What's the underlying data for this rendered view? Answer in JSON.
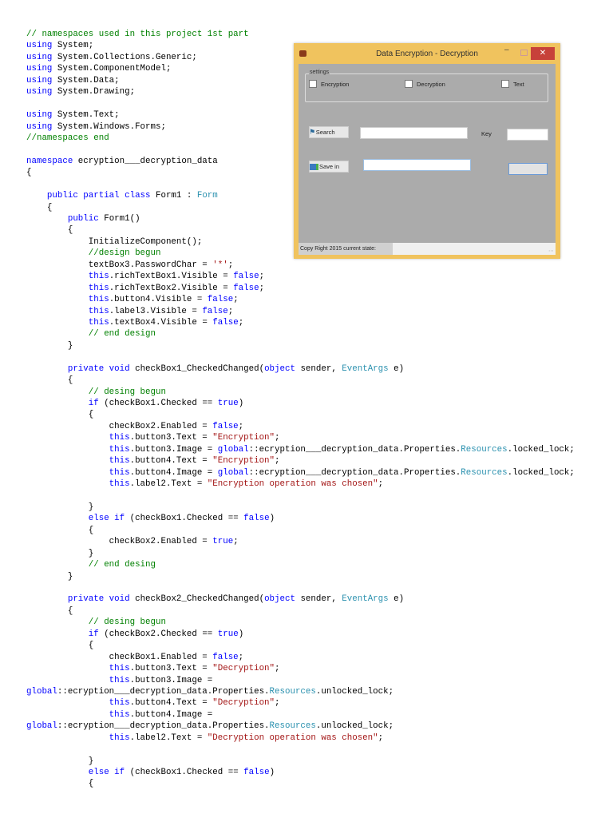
{
  "code_colors": {
    "keyword": "#0000ff",
    "comment": "#008000",
    "string": "#a31515",
    "type": "#2b91af"
  },
  "code_lines": [
    [
      [
        "// namespaces used in this project 1st part",
        "c"
      ]
    ],
    [
      [
        "using",
        "k"
      ],
      [
        " System;",
        "p"
      ]
    ],
    [
      [
        "using",
        "k"
      ],
      [
        " System.Collections.Generic;",
        "p"
      ]
    ],
    [
      [
        "using",
        "k"
      ],
      [
        " System.ComponentModel;",
        "p"
      ]
    ],
    [
      [
        "using",
        "k"
      ],
      [
        " System.Data;",
        "p"
      ]
    ],
    [
      [
        "using",
        "k"
      ],
      [
        " System.Drawing;",
        "p"
      ]
    ],
    [],
    [
      [
        "using",
        "k"
      ],
      [
        " System.Text;",
        "p"
      ]
    ],
    [
      [
        "using",
        "k"
      ],
      [
        " System.Windows.Forms;",
        "p"
      ]
    ],
    [
      [
        "//namespaces end",
        "c"
      ]
    ],
    [],
    [
      [
        "namespace",
        "k"
      ],
      [
        " ecryption___decryption_data",
        "p"
      ]
    ],
    [
      [
        "{",
        "p"
      ]
    ],
    [],
    [
      [
        "    ",
        "p"
      ],
      [
        "public partial class",
        "k"
      ],
      [
        " Form1 : ",
        "p"
      ],
      [
        "Form",
        "t"
      ]
    ],
    [
      [
        "    {",
        "p"
      ]
    ],
    [
      [
        "        ",
        "p"
      ],
      [
        "public",
        "k"
      ],
      [
        " Form1()",
        "p"
      ]
    ],
    [
      [
        "        {",
        "p"
      ]
    ],
    [
      [
        "            InitializeComponent();",
        "p"
      ]
    ],
    [
      [
        "            ",
        "p"
      ],
      [
        "//design begun",
        "c"
      ]
    ],
    [
      [
        "            textBox3.PasswordChar = ",
        "p"
      ],
      [
        "'*'",
        "s"
      ],
      [
        ";",
        "p"
      ]
    ],
    [
      [
        "            ",
        "p"
      ],
      [
        "this",
        "k"
      ],
      [
        ".richTextBox1.Visible = ",
        "p"
      ],
      [
        "false",
        "k"
      ],
      [
        ";",
        "p"
      ]
    ],
    [
      [
        "            ",
        "p"
      ],
      [
        "this",
        "k"
      ],
      [
        ".richTextBox2.Visible = ",
        "p"
      ],
      [
        "false",
        "k"
      ],
      [
        ";",
        "p"
      ]
    ],
    [
      [
        "            ",
        "p"
      ],
      [
        "this",
        "k"
      ],
      [
        ".button4.Visible = ",
        "p"
      ],
      [
        "false",
        "k"
      ],
      [
        ";",
        "p"
      ]
    ],
    [
      [
        "            ",
        "p"
      ],
      [
        "this",
        "k"
      ],
      [
        ".label3.Visible = ",
        "p"
      ],
      [
        "false",
        "k"
      ],
      [
        ";",
        "p"
      ]
    ],
    [
      [
        "            ",
        "p"
      ],
      [
        "this",
        "k"
      ],
      [
        ".textBox4.Visible = ",
        "p"
      ],
      [
        "false",
        "k"
      ],
      [
        ";",
        "p"
      ]
    ],
    [
      [
        "            ",
        "p"
      ],
      [
        "// end design",
        "c"
      ]
    ],
    [
      [
        "        }",
        "p"
      ]
    ],
    [],
    [
      [
        "        ",
        "p"
      ],
      [
        "private void",
        "k"
      ],
      [
        " checkBox1_CheckedChanged(",
        "p"
      ],
      [
        "object",
        "k"
      ],
      [
        " sender, ",
        "p"
      ],
      [
        "EventArgs",
        "t"
      ],
      [
        " e)",
        "p"
      ]
    ],
    [
      [
        "        {",
        "p"
      ]
    ],
    [
      [
        "            ",
        "p"
      ],
      [
        "// desing begun",
        "c"
      ]
    ],
    [
      [
        "            ",
        "p"
      ],
      [
        "if",
        "k"
      ],
      [
        " (checkBox1.Checked == ",
        "p"
      ],
      [
        "true",
        "k"
      ],
      [
        ")",
        "p"
      ]
    ],
    [
      [
        "            {",
        "p"
      ]
    ],
    [
      [
        "                checkBox2.Enabled = ",
        "p"
      ],
      [
        "false",
        "k"
      ],
      [
        ";",
        "p"
      ]
    ],
    [
      [
        "                ",
        "p"
      ],
      [
        "this",
        "k"
      ],
      [
        ".button3.Text = ",
        "p"
      ],
      [
        "\"Encryption\"",
        "s"
      ],
      [
        ";",
        "p"
      ]
    ],
    [
      [
        "                ",
        "p"
      ],
      [
        "this",
        "k"
      ],
      [
        ".button3.Image = ",
        "p"
      ],
      [
        "global",
        "k"
      ],
      [
        "::ecryption___decryption_data.Properties.",
        "p"
      ],
      [
        "Resources",
        "t"
      ],
      [
        ".locked_lock;",
        "p"
      ]
    ],
    [
      [
        "                ",
        "p"
      ],
      [
        "this",
        "k"
      ],
      [
        ".button4.Text = ",
        "p"
      ],
      [
        "\"Encryption\"",
        "s"
      ],
      [
        ";",
        "p"
      ]
    ],
    [
      [
        "                ",
        "p"
      ],
      [
        "this",
        "k"
      ],
      [
        ".button4.Image = ",
        "p"
      ],
      [
        "global",
        "k"
      ],
      [
        "::ecryption___decryption_data.Properties.",
        "p"
      ],
      [
        "Resources",
        "t"
      ],
      [
        ".locked_lock;",
        "p"
      ]
    ],
    [
      [
        "                ",
        "p"
      ],
      [
        "this",
        "k"
      ],
      [
        ".label2.Text = ",
        "p"
      ],
      [
        "\"Encryption operation was chosen\"",
        "s"
      ],
      [
        ";",
        "p"
      ]
    ],
    [],
    [
      [
        "            }",
        "p"
      ]
    ],
    [
      [
        "            ",
        "p"
      ],
      [
        "else if",
        "k"
      ],
      [
        " (checkBox1.Checked == ",
        "p"
      ],
      [
        "false",
        "k"
      ],
      [
        ")",
        "p"
      ]
    ],
    [
      [
        "            {",
        "p"
      ]
    ],
    [
      [
        "                checkBox2.Enabled = ",
        "p"
      ],
      [
        "true",
        "k"
      ],
      [
        ";",
        "p"
      ]
    ],
    [
      [
        "            }",
        "p"
      ]
    ],
    [
      [
        "            ",
        "p"
      ],
      [
        "// end desing",
        "c"
      ]
    ],
    [
      [
        "        }",
        "p"
      ]
    ],
    [],
    [
      [
        "        ",
        "p"
      ],
      [
        "private void",
        "k"
      ],
      [
        " checkBox2_CheckedChanged(",
        "p"
      ],
      [
        "object",
        "k"
      ],
      [
        " sender, ",
        "p"
      ],
      [
        "EventArgs",
        "t"
      ],
      [
        " e)",
        "p"
      ]
    ],
    [
      [
        "        {",
        "p"
      ]
    ],
    [
      [
        "            ",
        "p"
      ],
      [
        "// desing begun",
        "c"
      ]
    ],
    [
      [
        "            ",
        "p"
      ],
      [
        "if",
        "k"
      ],
      [
        " (checkBox2.Checked == ",
        "p"
      ],
      [
        "true",
        "k"
      ],
      [
        ")",
        "p"
      ]
    ],
    [
      [
        "            {",
        "p"
      ]
    ],
    [
      [
        "                checkBox1.Enabled = ",
        "p"
      ],
      [
        "false",
        "k"
      ],
      [
        ";",
        "p"
      ]
    ],
    [
      [
        "                ",
        "p"
      ],
      [
        "this",
        "k"
      ],
      [
        ".button3.Text = ",
        "p"
      ],
      [
        "\"Decryption\"",
        "s"
      ],
      [
        ";",
        "p"
      ]
    ],
    [
      [
        "                ",
        "p"
      ],
      [
        "this",
        "k"
      ],
      [
        ".button3.Image =",
        "p"
      ]
    ],
    [
      [
        "global",
        "k"
      ],
      [
        "::ecryption___decryption_data.Properties.",
        "p"
      ],
      [
        "Resources",
        "t"
      ],
      [
        ".unlocked_lock;",
        "p"
      ]
    ],
    [
      [
        "                ",
        "p"
      ],
      [
        "this",
        "k"
      ],
      [
        ".button4.Text = ",
        "p"
      ],
      [
        "\"Decryption\"",
        "s"
      ],
      [
        ";",
        "p"
      ]
    ],
    [
      [
        "                ",
        "p"
      ],
      [
        "this",
        "k"
      ],
      [
        ".button4.Image =",
        "p"
      ]
    ],
    [
      [
        "global",
        "k"
      ],
      [
        "::ecryption___decryption_data.Properties.",
        "p"
      ],
      [
        "Resources",
        "t"
      ],
      [
        ".unlocked_lock;",
        "p"
      ]
    ],
    [
      [
        "                ",
        "p"
      ],
      [
        "this",
        "k"
      ],
      [
        ".label2.Text = ",
        "p"
      ],
      [
        "\"Decryption operation was chosen\"",
        "s"
      ],
      [
        ";",
        "p"
      ]
    ],
    [],
    [
      [
        "            }",
        "p"
      ]
    ],
    [
      [
        "            ",
        "p"
      ],
      [
        "else if",
        "k"
      ],
      [
        " (checkBox1.Checked == ",
        "p"
      ],
      [
        "false",
        "k"
      ],
      [
        ")",
        "p"
      ]
    ],
    [
      [
        "            {",
        "p"
      ]
    ]
  ],
  "form": {
    "title": "Data Encryption - Decryption",
    "close_glyph": "✕",
    "minimize_glyph": "–",
    "title_bar_color": "#f0c35e",
    "group_label": "settings",
    "checkboxes": [
      {
        "label": "Encryption",
        "checked": false
      },
      {
        "label": "Decryption",
        "checked": false
      },
      {
        "label": "Text",
        "checked": false
      }
    ],
    "search_button": "Search",
    "save_button": "Save in",
    "key_label": "Key",
    "status_text": "Copy Right 2015  current state:",
    "search_path": "",
    "save_path": "",
    "key_value": ""
  }
}
